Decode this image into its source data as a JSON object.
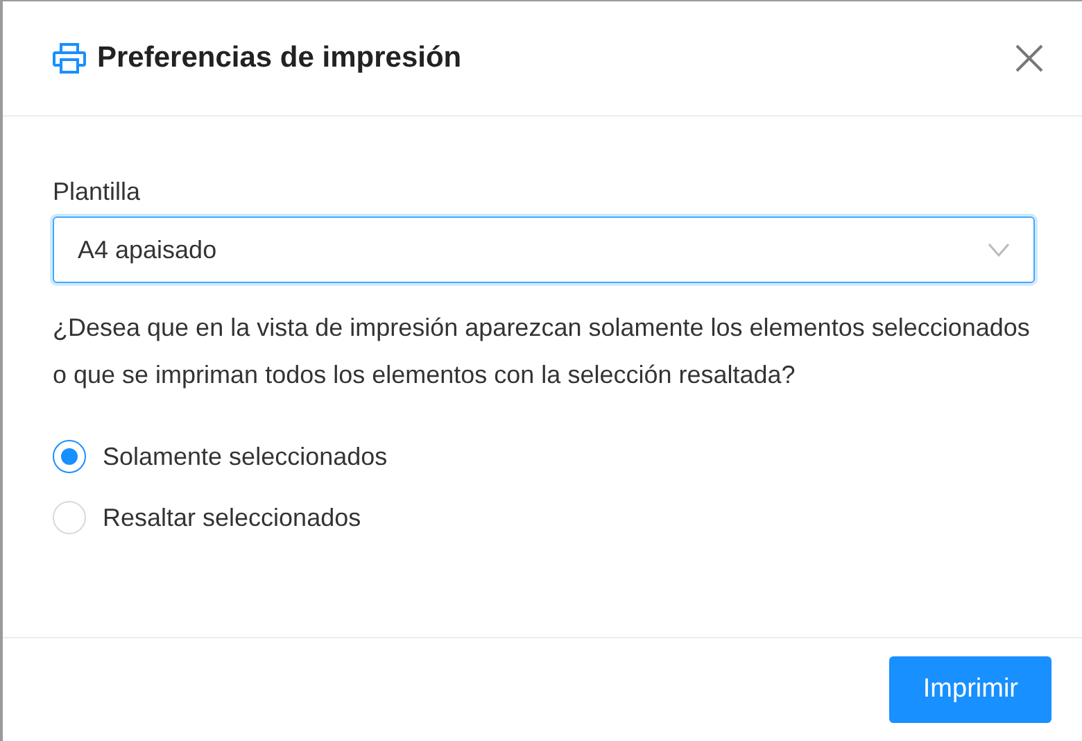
{
  "dialog": {
    "title": "Preferencias de impresión"
  },
  "template": {
    "label": "Plantilla",
    "value": "A4 apaisado"
  },
  "question": "¿Desea que en la vista de impresión aparezcan solamente los elementos seleccionados o que se impriman todos los elementos con la selección resaltada?",
  "options": [
    {
      "label": "Solamente seleccionados",
      "selected": true
    },
    {
      "label": "Resaltar seleccionados",
      "selected": false
    }
  ],
  "buttons": [
    {
      "label": "Imprimir"
    }
  ]
}
